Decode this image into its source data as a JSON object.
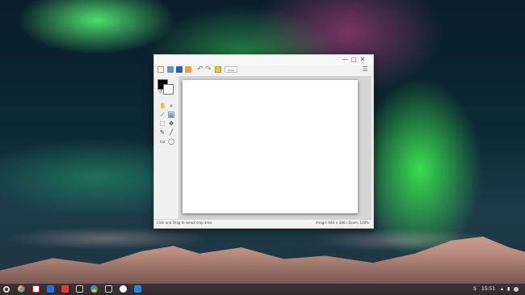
{
  "window": {
    "title_controls": [
      "—",
      "□",
      "✕"
    ],
    "status": {
      "left": "Click and Drag to select crop area",
      "right": "Image: 640 × 480 / Zoom: 100%"
    },
    "toolbar": {
      "apply_label": "Apply"
    }
  },
  "shelf": {
    "tray": {
      "time": "15:51",
      "user_initial": "S"
    }
  },
  "colors": {
    "selected_tool_bg": "#dbe6f5",
    "selected_tool_border": "#7b9cc6",
    "shelf_bg": "#141920"
  },
  "icons": {
    "shelf": [
      "chrome-icon",
      "gmail-icon",
      "docs-icon",
      "youtube-icon",
      "files-icon",
      "google-drive-icon",
      "image-editor-icon",
      "chat-icon",
      "camera-icon"
    ]
  }
}
